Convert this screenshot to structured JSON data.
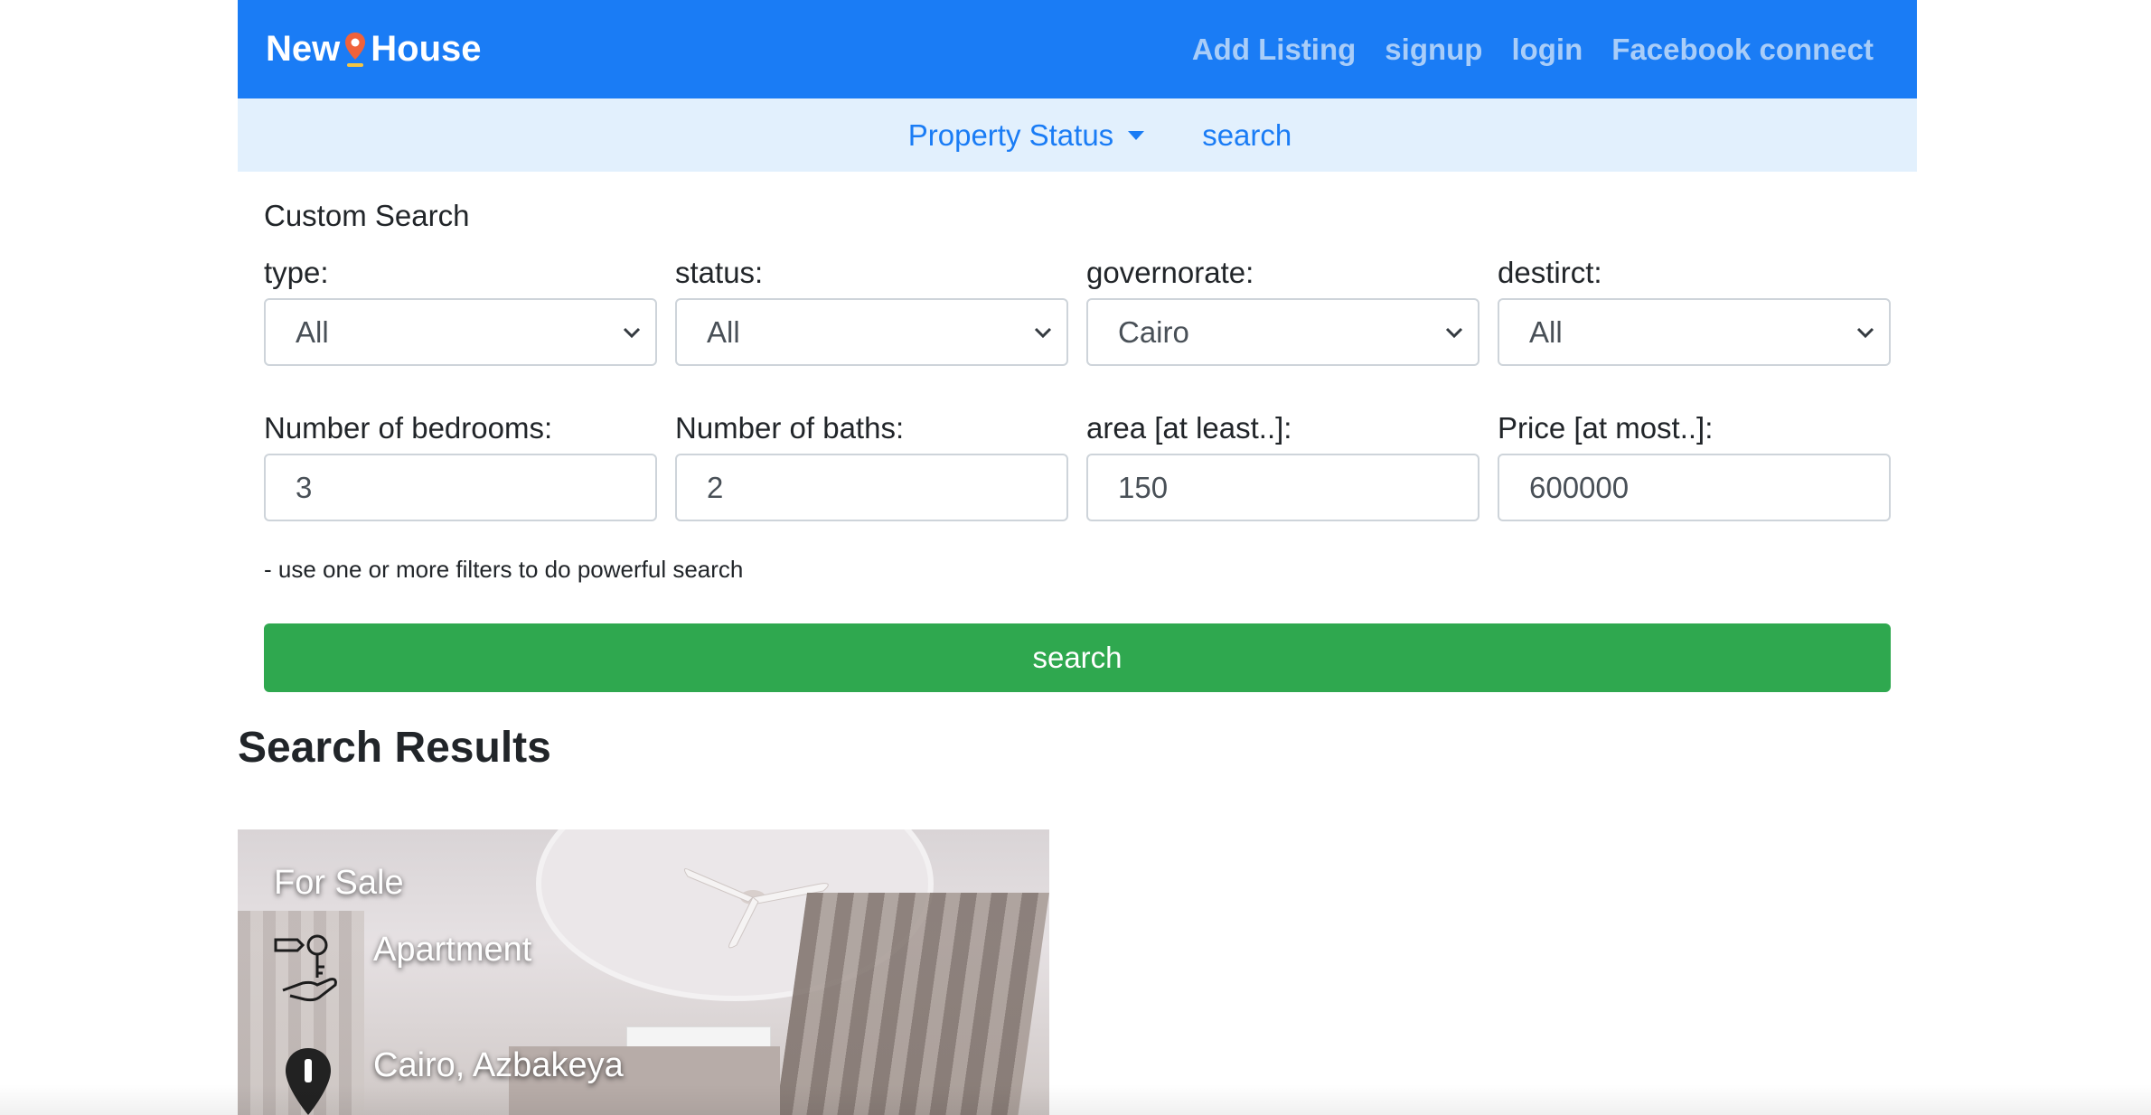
{
  "navbar": {
    "brand_left": "New",
    "brand_right": "House",
    "links": [
      "Add Listing",
      "signup",
      "login",
      "Facebook connect"
    ]
  },
  "subnav": {
    "dropdown_label": "Property Status",
    "search_link": "search"
  },
  "form": {
    "title": "Custom Search",
    "type": {
      "label": "type:",
      "value": "All"
    },
    "status": {
      "label": "status:",
      "value": "All"
    },
    "governorate": {
      "label": "governorate:",
      "value": "Cairo"
    },
    "district": {
      "label": "destirct:",
      "value": "All"
    },
    "bedrooms": {
      "label": "Number of bedrooms:",
      "value": "3"
    },
    "baths": {
      "label": "Number of baths:",
      "value": "2"
    },
    "area": {
      "label": "area [at least..]:",
      "value": "150"
    },
    "price": {
      "label": "Price [at most..]:",
      "value": "600000"
    },
    "hint": "- use one or more filters to do powerful search",
    "search_button": "search"
  },
  "results": {
    "title": "Search Results",
    "cards": [
      {
        "status": "For Sale",
        "type": "Apartment",
        "location": "Cairo, Azbakeya"
      }
    ]
  },
  "colors": {
    "navbar": "#1a7cf5",
    "subnav": "#e2f0fd",
    "search_button": "#2fa84f",
    "nav_link": "#a9cdf8"
  }
}
